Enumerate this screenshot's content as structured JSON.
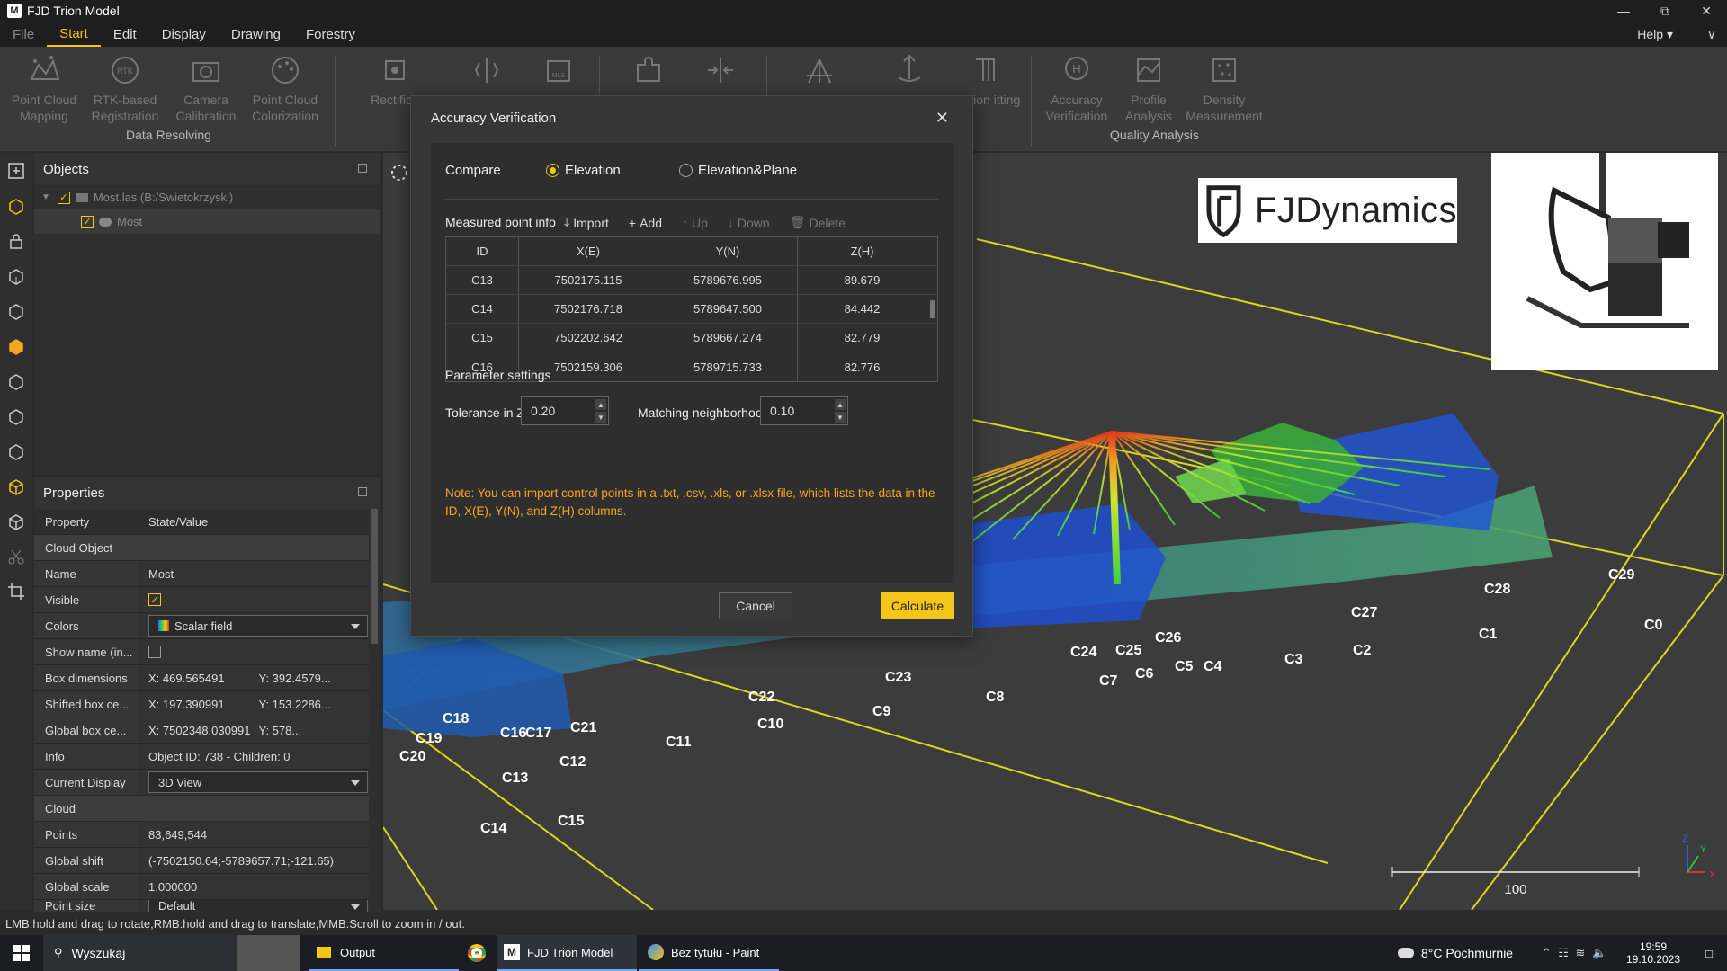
{
  "window": {
    "title": "FJD Trion Model",
    "logo": "M"
  },
  "menu": {
    "items": [
      {
        "label": "File",
        "state": "dim"
      },
      {
        "label": "Start",
        "state": "active"
      },
      {
        "label": "Edit",
        "state": ""
      },
      {
        "label": "Display",
        "state": ""
      },
      {
        "label": "Drawing",
        "state": ""
      },
      {
        "label": "Forestry",
        "state": ""
      }
    ],
    "help": "Help"
  },
  "ribbon": {
    "buttons": [
      {
        "label": "Point Cloud Mapping",
        "icon": "point-cloud-mapping-icon"
      },
      {
        "label": "RTK-based Registration",
        "icon": "rtk-icon"
      },
      {
        "label": "Camera Calibration",
        "icon": "camera-icon"
      },
      {
        "label": "Point Cloud Colorization",
        "icon": "palette-icon"
      },
      {
        "label": "Rectifica",
        "icon": "rectification-icon"
      },
      {
        "label": "",
        "icon": "split-icon"
      },
      {
        "label": "",
        "icon": "mls-icon"
      },
      {
        "label": "",
        "icon": "puzzle-icon"
      },
      {
        "label": "",
        "icon": "merge-icon"
      },
      {
        "label": "",
        "icon": "tripod-icon"
      },
      {
        "label": "",
        "icon": "move-icon"
      },
      {
        "label": "evation itting",
        "icon": "elevation-fitting-icon"
      },
      {
        "label": "Accuracy Verification",
        "icon": "accuracy-icon"
      },
      {
        "label": "Profile Analysis",
        "icon": "profile-icon"
      },
      {
        "label": "Density Measurement",
        "icon": "density-icon"
      }
    ],
    "groups": {
      "data_resolving": "Data Resolving",
      "quality_analysis": "Quality Analysis"
    }
  },
  "objects_panel": {
    "title": "Objects",
    "tree": [
      {
        "label": "Most.las (B:/Swietokrzyski)",
        "level": 0
      },
      {
        "label": "Most",
        "level": 1
      }
    ]
  },
  "properties_panel": {
    "title": "Properties",
    "header": {
      "property": "Property",
      "value": "State/Value"
    },
    "rows": [
      {
        "type": "section",
        "key": "Cloud Object"
      },
      {
        "key": "Name",
        "value": "Most"
      },
      {
        "key": "Visible",
        "value": "✓",
        "kind": "check"
      },
      {
        "key": "Colors",
        "value": "Scalar field",
        "kind": "combo"
      },
      {
        "key": "Show name (in...",
        "value": "",
        "kind": "check-empty"
      },
      {
        "key": "Box dimensions",
        "value": "X: 469.565491",
        "value2": "Y: 392.4579..."
      },
      {
        "key": "Shifted box ce...",
        "value": "X: 197.390991",
        "value2": "Y: 153.2286..."
      },
      {
        "key": "Global box ce...",
        "value": "X: 7502348.030991",
        "value2": "Y: 578..."
      },
      {
        "key": "Info",
        "value": "Object ID: 738 - Children: 0"
      },
      {
        "key": "Current Display",
        "value": "3D View",
        "kind": "combo"
      },
      {
        "type": "section",
        "key": "Cloud"
      },
      {
        "key": "Points",
        "value": "83,649,544"
      },
      {
        "key": "Global shift",
        "value": "(-7502150.64;-5789657.71;-121.65)"
      },
      {
        "key": "Global scale",
        "value": "1.000000"
      },
      {
        "key": "Point size",
        "value": "Default",
        "kind": "combo"
      }
    ]
  },
  "dialog": {
    "title": "Accuracy Verification",
    "compare_label": "Compare",
    "radio_elevation": "Elevation",
    "radio_elevation_plane": "Elevation&Plane",
    "measured_label": "Measured point info",
    "toolbar": {
      "import": "Import",
      "add": "Add",
      "up": "Up",
      "down": "Down",
      "delete": "Delete"
    },
    "columns": [
      "ID",
      "X(E)",
      "Y(N)",
      "Z(H)"
    ],
    "rows": [
      [
        "C13",
        "7502175.115",
        "5789676.995",
        "89.679"
      ],
      [
        "C14",
        "7502176.718",
        "5789647.500",
        "84.442"
      ],
      [
        "C15",
        "7502202.642",
        "5789667.274",
        "82.779"
      ],
      [
        "C16",
        "7502159.306",
        "5789715.733",
        "82.776"
      ]
    ],
    "param_label": "Parameter settings",
    "tolerance_label": "Tolerance in Z",
    "tolerance_value": "0.20",
    "neighborhood_label": "Matching neighborhood",
    "neighborhood_value": "0.10",
    "note": "Note: You can import control points in a .txt, .csv, .xls, or .xlsx file, which lists the data in the ID, X(E), Y(N), and Z(H) columns.",
    "cancel": "Cancel",
    "calculate": "Calculate"
  },
  "viewport": {
    "brand": "FJDynamics",
    "scale_value": "100",
    "axis_x": "X",
    "axis_y": "Y",
    "axis_z": "Z",
    "labels": [
      "C0",
      "C1",
      "C2",
      "C3",
      "C4",
      "C5",
      "C6",
      "C7",
      "C8",
      "C9",
      "C10",
      "C11",
      "C12",
      "C13",
      "C14",
      "C15",
      "C16",
      "C17",
      "C18",
      "C19",
      "C20",
      "C21",
      "C22",
      "C23",
      "C24",
      "C25",
      "C26",
      "C27",
      "C28",
      "C29"
    ]
  },
  "status": {
    "hint": "LMB:hold and drag to rotate,RMB:hold and drag to translate,MMB:Scroll to zoom in / out."
  },
  "taskbar": {
    "search": "Wyszukaj",
    "apps": [
      "Output",
      "FJD Trion Model",
      "Bez tytułu - Paint"
    ],
    "weather": "8°C  Pochmurnie",
    "time": "19:59",
    "date": "19.10.2023"
  },
  "colors": {
    "accent": "#f5c518",
    "note": "#f5a623",
    "bg": "#2b2b2b"
  }
}
